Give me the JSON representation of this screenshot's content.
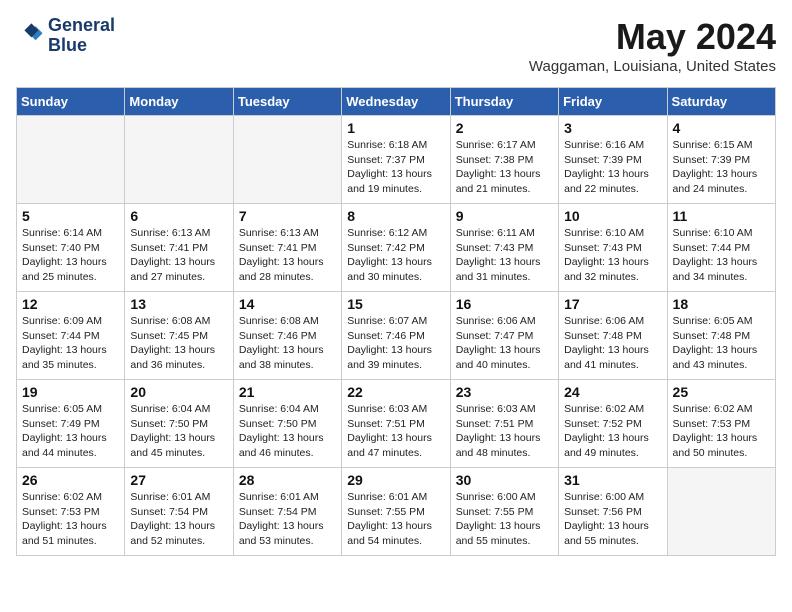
{
  "header": {
    "logo_line1": "General",
    "logo_line2": "Blue",
    "month": "May 2024",
    "location": "Waggaman, Louisiana, United States"
  },
  "weekdays": [
    "Sunday",
    "Monday",
    "Tuesday",
    "Wednesday",
    "Thursday",
    "Friday",
    "Saturday"
  ],
  "weeks": [
    [
      {
        "day": "",
        "info": ""
      },
      {
        "day": "",
        "info": ""
      },
      {
        "day": "",
        "info": ""
      },
      {
        "day": "1",
        "info": "Sunrise: 6:18 AM\nSunset: 7:37 PM\nDaylight: 13 hours\nand 19 minutes."
      },
      {
        "day": "2",
        "info": "Sunrise: 6:17 AM\nSunset: 7:38 PM\nDaylight: 13 hours\nand 21 minutes."
      },
      {
        "day": "3",
        "info": "Sunrise: 6:16 AM\nSunset: 7:39 PM\nDaylight: 13 hours\nand 22 minutes."
      },
      {
        "day": "4",
        "info": "Sunrise: 6:15 AM\nSunset: 7:39 PM\nDaylight: 13 hours\nand 24 minutes."
      }
    ],
    [
      {
        "day": "5",
        "info": "Sunrise: 6:14 AM\nSunset: 7:40 PM\nDaylight: 13 hours\nand 25 minutes."
      },
      {
        "day": "6",
        "info": "Sunrise: 6:13 AM\nSunset: 7:41 PM\nDaylight: 13 hours\nand 27 minutes."
      },
      {
        "day": "7",
        "info": "Sunrise: 6:13 AM\nSunset: 7:41 PM\nDaylight: 13 hours\nand 28 minutes."
      },
      {
        "day": "8",
        "info": "Sunrise: 6:12 AM\nSunset: 7:42 PM\nDaylight: 13 hours\nand 30 minutes."
      },
      {
        "day": "9",
        "info": "Sunrise: 6:11 AM\nSunset: 7:43 PM\nDaylight: 13 hours\nand 31 minutes."
      },
      {
        "day": "10",
        "info": "Sunrise: 6:10 AM\nSunset: 7:43 PM\nDaylight: 13 hours\nand 32 minutes."
      },
      {
        "day": "11",
        "info": "Sunrise: 6:10 AM\nSunset: 7:44 PM\nDaylight: 13 hours\nand 34 minutes."
      }
    ],
    [
      {
        "day": "12",
        "info": "Sunrise: 6:09 AM\nSunset: 7:44 PM\nDaylight: 13 hours\nand 35 minutes."
      },
      {
        "day": "13",
        "info": "Sunrise: 6:08 AM\nSunset: 7:45 PM\nDaylight: 13 hours\nand 36 minutes."
      },
      {
        "day": "14",
        "info": "Sunrise: 6:08 AM\nSunset: 7:46 PM\nDaylight: 13 hours\nand 38 minutes."
      },
      {
        "day": "15",
        "info": "Sunrise: 6:07 AM\nSunset: 7:46 PM\nDaylight: 13 hours\nand 39 minutes."
      },
      {
        "day": "16",
        "info": "Sunrise: 6:06 AM\nSunset: 7:47 PM\nDaylight: 13 hours\nand 40 minutes."
      },
      {
        "day": "17",
        "info": "Sunrise: 6:06 AM\nSunset: 7:48 PM\nDaylight: 13 hours\nand 41 minutes."
      },
      {
        "day": "18",
        "info": "Sunrise: 6:05 AM\nSunset: 7:48 PM\nDaylight: 13 hours\nand 43 minutes."
      }
    ],
    [
      {
        "day": "19",
        "info": "Sunrise: 6:05 AM\nSunset: 7:49 PM\nDaylight: 13 hours\nand 44 minutes."
      },
      {
        "day": "20",
        "info": "Sunrise: 6:04 AM\nSunset: 7:50 PM\nDaylight: 13 hours\nand 45 minutes."
      },
      {
        "day": "21",
        "info": "Sunrise: 6:04 AM\nSunset: 7:50 PM\nDaylight: 13 hours\nand 46 minutes."
      },
      {
        "day": "22",
        "info": "Sunrise: 6:03 AM\nSunset: 7:51 PM\nDaylight: 13 hours\nand 47 minutes."
      },
      {
        "day": "23",
        "info": "Sunrise: 6:03 AM\nSunset: 7:51 PM\nDaylight: 13 hours\nand 48 minutes."
      },
      {
        "day": "24",
        "info": "Sunrise: 6:02 AM\nSunset: 7:52 PM\nDaylight: 13 hours\nand 49 minutes."
      },
      {
        "day": "25",
        "info": "Sunrise: 6:02 AM\nSunset: 7:53 PM\nDaylight: 13 hours\nand 50 minutes."
      }
    ],
    [
      {
        "day": "26",
        "info": "Sunrise: 6:02 AM\nSunset: 7:53 PM\nDaylight: 13 hours\nand 51 minutes."
      },
      {
        "day": "27",
        "info": "Sunrise: 6:01 AM\nSunset: 7:54 PM\nDaylight: 13 hours\nand 52 minutes."
      },
      {
        "day": "28",
        "info": "Sunrise: 6:01 AM\nSunset: 7:54 PM\nDaylight: 13 hours\nand 53 minutes."
      },
      {
        "day": "29",
        "info": "Sunrise: 6:01 AM\nSunset: 7:55 PM\nDaylight: 13 hours\nand 54 minutes."
      },
      {
        "day": "30",
        "info": "Sunrise: 6:00 AM\nSunset: 7:55 PM\nDaylight: 13 hours\nand 55 minutes."
      },
      {
        "day": "31",
        "info": "Sunrise: 6:00 AM\nSunset: 7:56 PM\nDaylight: 13 hours\nand 55 minutes."
      },
      {
        "day": "",
        "info": ""
      }
    ]
  ]
}
